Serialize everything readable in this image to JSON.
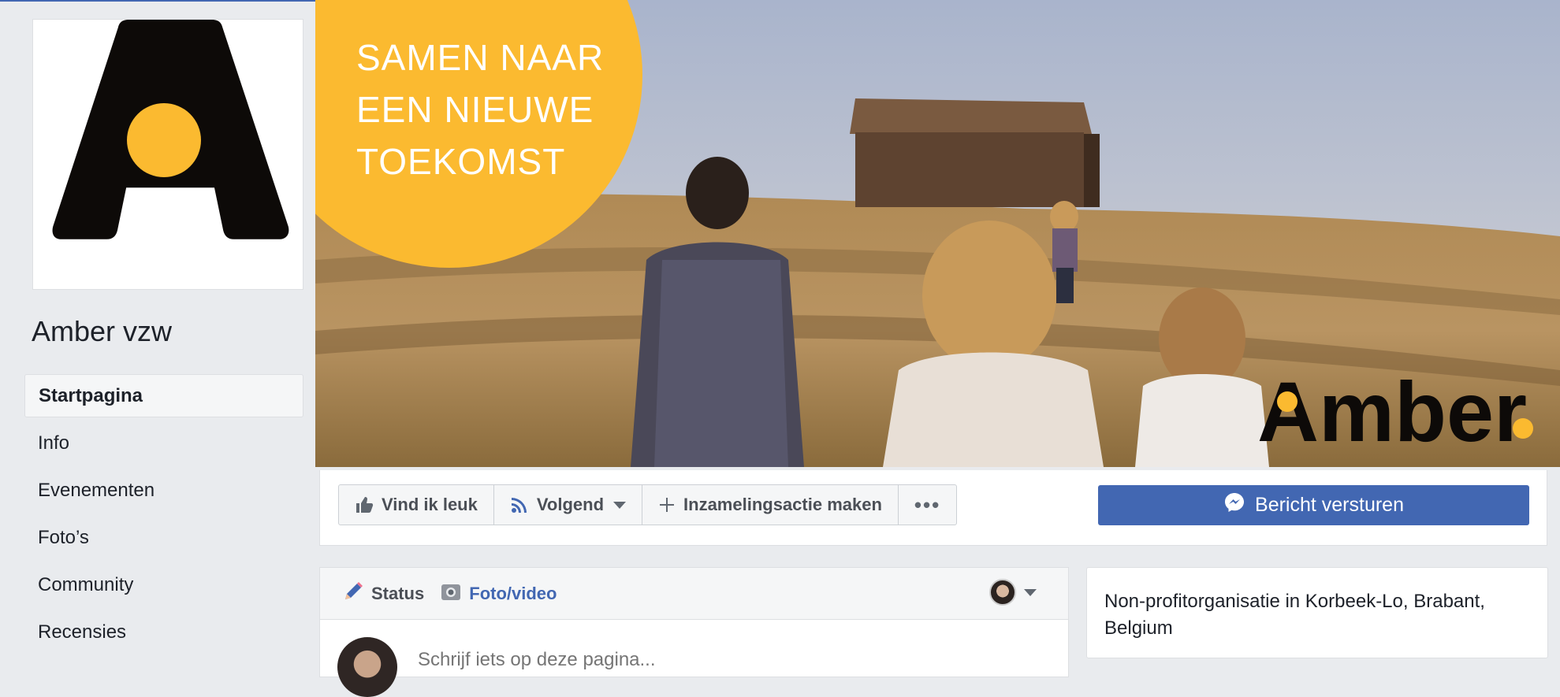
{
  "page": {
    "name": "Amber vzw"
  },
  "sidebar": {
    "items": [
      {
        "label": "Startpagina",
        "active": true
      },
      {
        "label": "Info"
      },
      {
        "label": "Evenementen"
      },
      {
        "label": "Foto’s"
      },
      {
        "label": "Community"
      },
      {
        "label": "Recensies"
      }
    ]
  },
  "cover": {
    "slogan": "SAMEN NAAR\nEEN NIEUWE\nTOEKOMST",
    "brand_word": "Amber",
    "accent_color": "#fbba30"
  },
  "actions": {
    "like_label": "Vind ik leuk",
    "follow_label": "Volgend",
    "fundraiser_label": "Inzamelingsactie maken",
    "more_label": "•••",
    "send_label": "Bericht versturen"
  },
  "composer": {
    "status_label": "Status",
    "photo_label": "Foto/video",
    "placeholder": "Schrijf iets op deze pagina..."
  },
  "about": {
    "category_text": "Non-profitorganisatie in Korbeek-Lo, Brabant, Belgium"
  },
  "colors": {
    "brand_blue": "#4267b2",
    "background": "#e9ebee",
    "logo_black": "#0d0a08"
  }
}
